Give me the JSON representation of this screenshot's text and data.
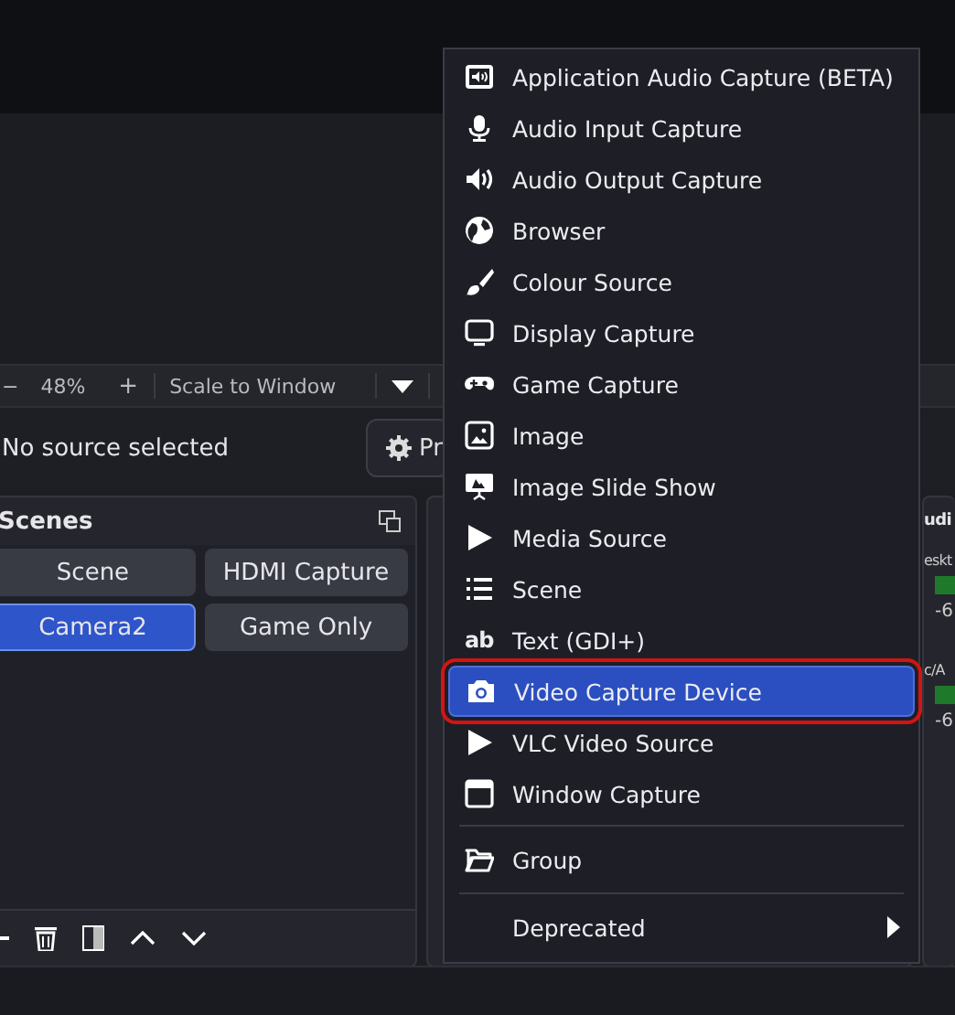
{
  "toolbar": {
    "zoom_out": "−",
    "zoom": "48%",
    "zoom_in": "+",
    "scale": "Scale to Window"
  },
  "source_bar": {
    "label": "No source selected",
    "properties_button": "Pr"
  },
  "scenes_dock": {
    "title": "Scenes",
    "scenes": [
      {
        "label": "Scene",
        "selected": false
      },
      {
        "label": "HDMI Capture",
        "selected": false
      },
      {
        "label": "Camera2",
        "selected": true
      },
      {
        "label": "Game Only",
        "selected": false
      }
    ]
  },
  "audio_dock": {
    "title": "udi",
    "channels": [
      {
        "name": "eskt",
        "reading": "-6"
      },
      {
        "name": "c/A",
        "reading": "-6"
      }
    ]
  },
  "context_menu": {
    "items": [
      {
        "kind": "item",
        "label": "Application Audio Capture (BETA)",
        "selected": false,
        "highlighted": false
      },
      {
        "kind": "item",
        "label": "Audio Input Capture",
        "selected": false,
        "highlighted": false
      },
      {
        "kind": "item",
        "label": "Audio Output Capture",
        "selected": false,
        "highlighted": false
      },
      {
        "kind": "item",
        "label": "Browser",
        "selected": false,
        "highlighted": false
      },
      {
        "kind": "item",
        "label": "Colour Source",
        "selected": false,
        "highlighted": false
      },
      {
        "kind": "item",
        "label": "Display Capture",
        "selected": false,
        "highlighted": false
      },
      {
        "kind": "item",
        "label": "Game Capture",
        "selected": false,
        "highlighted": false
      },
      {
        "kind": "item",
        "label": "Image",
        "selected": false,
        "highlighted": false
      },
      {
        "kind": "item",
        "label": "Image Slide Show",
        "selected": false,
        "highlighted": false
      },
      {
        "kind": "item",
        "label": "Media Source",
        "selected": false,
        "highlighted": false
      },
      {
        "kind": "item",
        "label": "Scene",
        "selected": false,
        "highlighted": false
      },
      {
        "kind": "item",
        "label": "Text (GDI+)",
        "icon_text": "ab",
        "selected": false,
        "highlighted": false
      },
      {
        "kind": "item",
        "label": "Video Capture Device",
        "selected": true,
        "highlighted": true
      },
      {
        "kind": "item",
        "label": "VLC Video Source",
        "selected": false,
        "highlighted": false
      },
      {
        "kind": "item",
        "label": "Window Capture",
        "selected": false,
        "highlighted": false
      },
      {
        "kind": "separator"
      },
      {
        "kind": "item",
        "label": "Group",
        "selected": false,
        "highlighted": false
      },
      {
        "kind": "separator"
      },
      {
        "kind": "submenu",
        "label": "Deprecated",
        "selected": false,
        "highlighted": false
      }
    ]
  }
}
